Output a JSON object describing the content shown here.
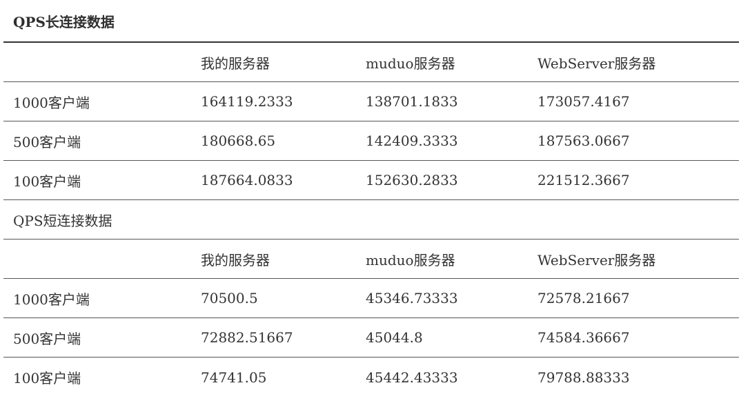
{
  "long_connection": {
    "title": "QPS长连接数据",
    "header": [
      "",
      "我的服务器",
      "muduo服务器",
      "WebServer服务器"
    ],
    "rows": [
      [
        "1000客户端",
        "164119.2333",
        "138701.1833",
        "173057.4167"
      ],
      [
        "500客户端",
        "180668.65",
        "142409.3333",
        "187563.0667"
      ],
      [
        "100客户端",
        "187664.0833",
        "152630.2833",
        "221512.3667"
      ]
    ]
  },
  "short_connection": {
    "title": "QPS短连接数据",
    "header": [
      "",
      "我的服务器",
      "muduo服务器",
      "WebServer服务器"
    ],
    "rows": [
      [
        "1000客户端",
        "70500.5",
        "45346.73333",
        "72578.21667"
      ],
      [
        "500客户端",
        "72882.51667",
        "45044.8",
        "74584.36667"
      ],
      [
        "100客户端",
        "74741.05",
        "45442.43333",
        "79788.88333"
      ]
    ]
  }
}
